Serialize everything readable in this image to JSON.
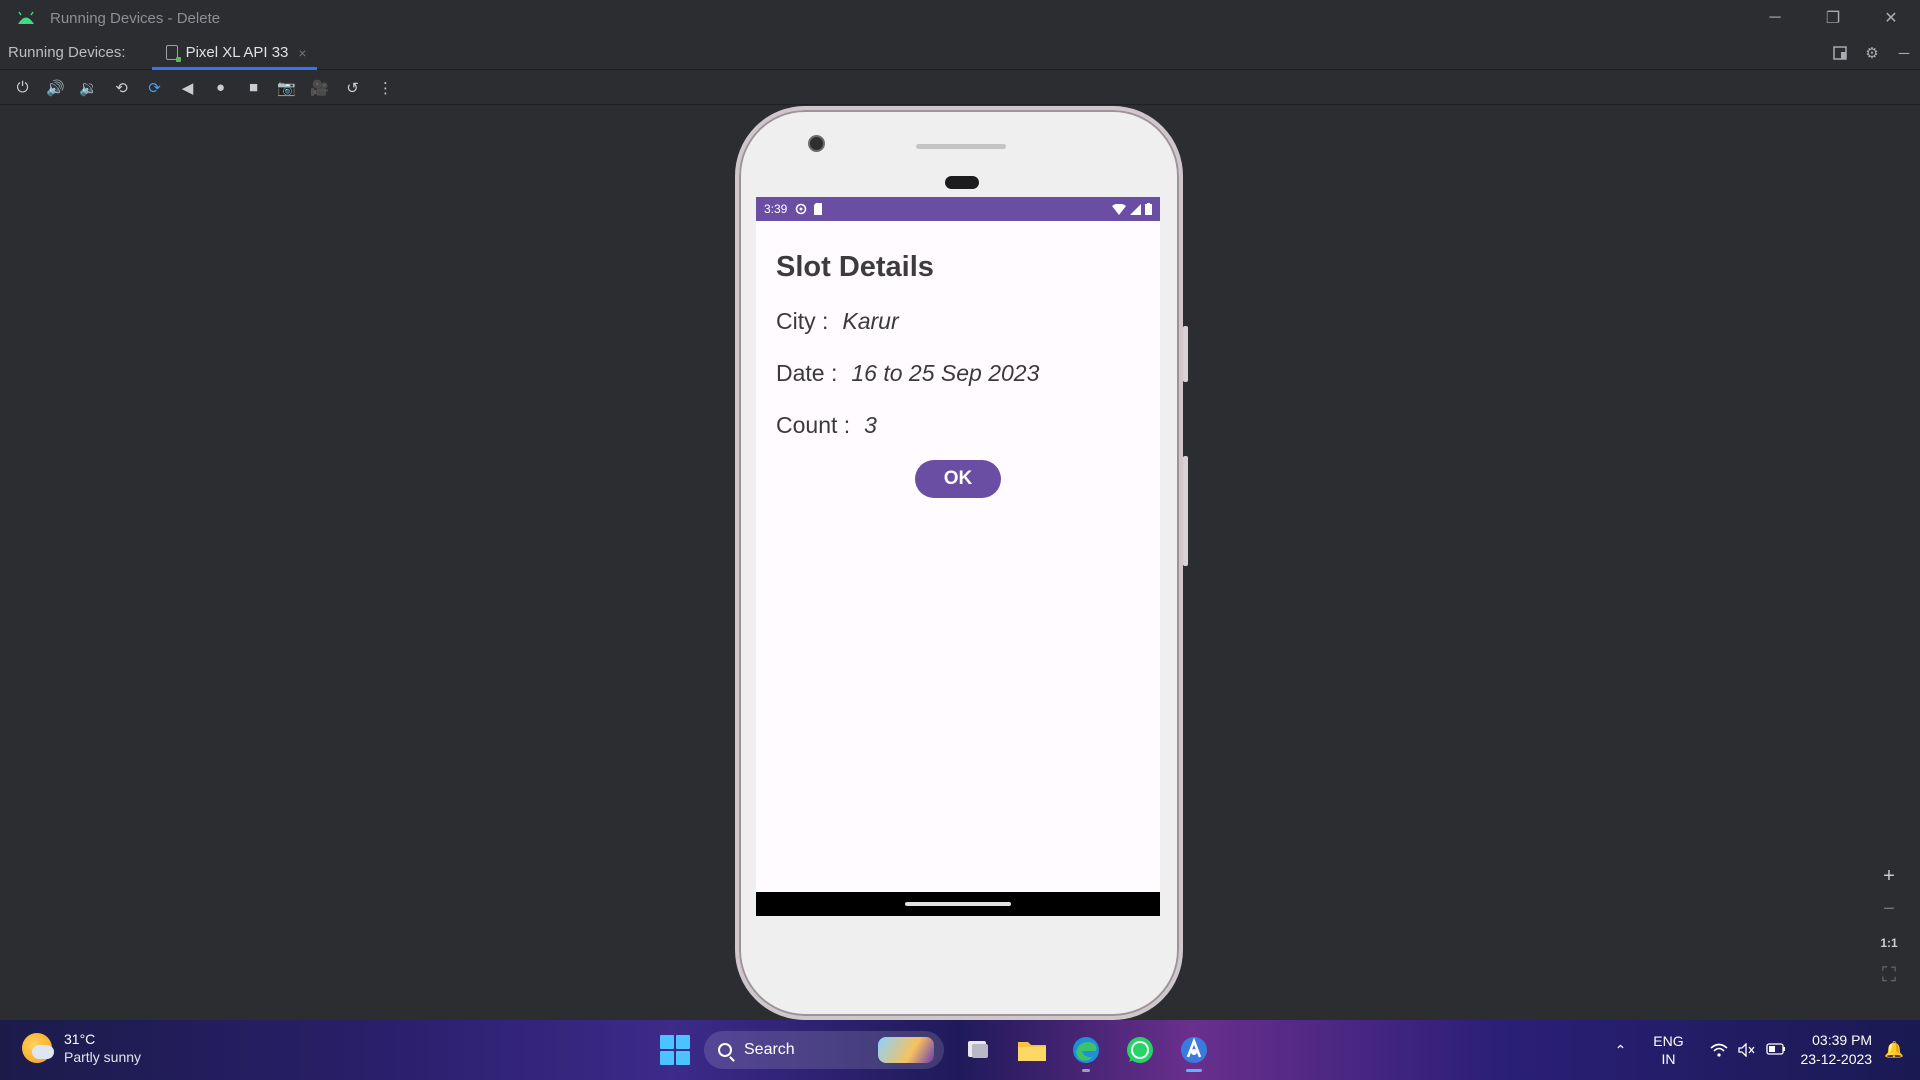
{
  "window": {
    "title": "Running Devices - Delete",
    "controls": {
      "minimize": "─",
      "restore": "❐",
      "close": "✕"
    }
  },
  "tabbar": {
    "label": "Running Devices:",
    "tabs": [
      {
        "label": "Pixel XL API 33",
        "close": "×"
      }
    ]
  },
  "toolbar": {
    "buttons": [
      {
        "name": "power",
        "glyph": "⏻"
      },
      {
        "name": "volume-up",
        "glyph": "🔊"
      },
      {
        "name": "volume-down",
        "glyph": "🔉"
      },
      {
        "name": "rotate-left",
        "glyph": "⟲"
      },
      {
        "name": "rotate-right",
        "glyph": "⟳"
      },
      {
        "name": "back",
        "glyph": "◀"
      },
      {
        "name": "home",
        "glyph": "●"
      },
      {
        "name": "overview",
        "glyph": "■"
      },
      {
        "name": "screenshot",
        "glyph": "📷"
      },
      {
        "name": "screen-record",
        "glyph": "🎥"
      },
      {
        "name": "reset",
        "glyph": "↺"
      },
      {
        "name": "more",
        "glyph": "⋮"
      }
    ]
  },
  "device": {
    "status_time": "3:39",
    "app": {
      "heading": "Slot Details",
      "rows": [
        {
          "key": "City :",
          "value": "Karur"
        },
        {
          "key": "Date :",
          "value": "16 to 25 Sep 2023"
        },
        {
          "key": "Count :",
          "value": "3"
        }
      ],
      "ok_label": "OK"
    }
  },
  "zoom": {
    "in": "+",
    "out": "−",
    "actual": "1:1",
    "fit": "⛶"
  },
  "taskbar": {
    "weather": {
      "temp": "31°C",
      "desc": "Partly sunny"
    },
    "search_label": "Search",
    "lang": {
      "line1": "ENG",
      "line2": "IN"
    },
    "clock": {
      "time": "03:39 PM",
      "date": "23-12-2023"
    }
  },
  "colors": {
    "accent": "#6a4ea3",
    "ide_bg": "#2b2d30",
    "tab_underline": "#3574f0"
  }
}
